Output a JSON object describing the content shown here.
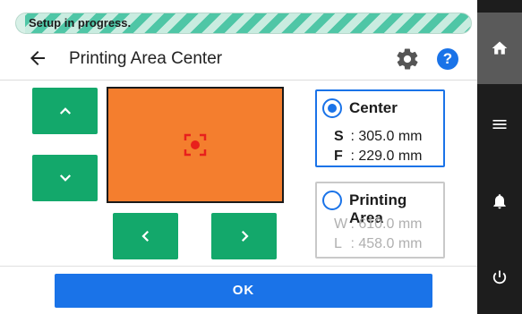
{
  "status": {
    "text": "Setup in progress.",
    "progress_percent": 2
  },
  "header": {
    "title": "Printing Area Center",
    "back_icon": "back-arrow-icon",
    "settings_icon": "gear-icon",
    "help_label": "?"
  },
  "preview": {
    "fill_color": "#f47e2e",
    "target_color": "#e8201c"
  },
  "center_option": {
    "label": "Center",
    "selected": true,
    "rows": [
      {
        "key": "S",
        "value": ": 305.0 mm"
      },
      {
        "key": "F",
        "value": ": 229.0 mm"
      }
    ]
  },
  "area_option": {
    "label": "Printing Area",
    "selected": false,
    "rows": [
      {
        "key": "W",
        "value": ": 610.0 mm"
      },
      {
        "key": "L",
        "value": ": 458.0 mm"
      }
    ]
  },
  "footer": {
    "ok_label": "OK"
  },
  "colors": {
    "accent": "#1a73e8",
    "button_green": "#13a86b",
    "sidebar": "#1d1d1d"
  },
  "sidebar": {
    "items": [
      "home-icon",
      "menu-icon",
      "bell-icon",
      "power-icon"
    ]
  }
}
